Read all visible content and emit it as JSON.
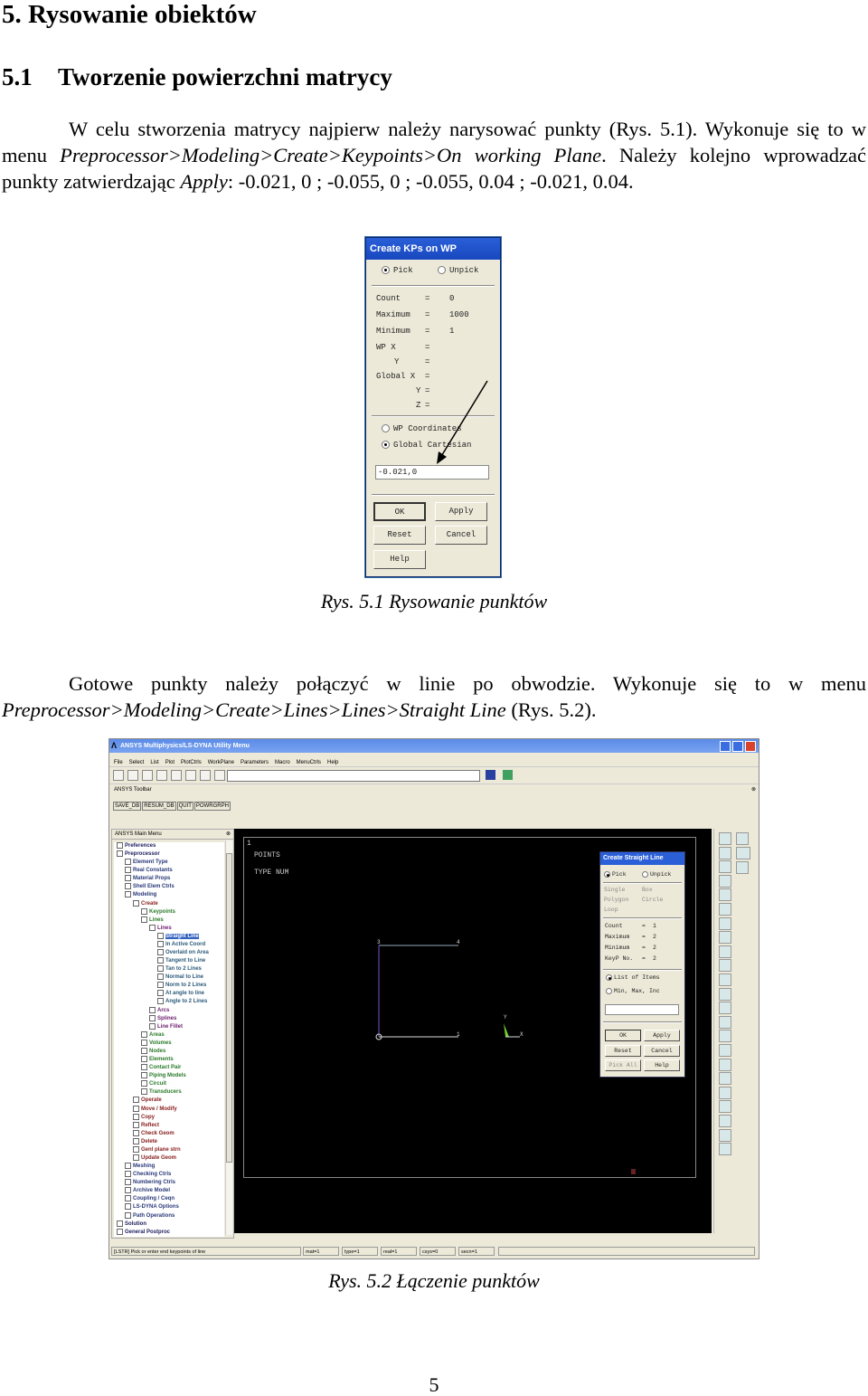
{
  "heading": "5. Rysowanie obiektów",
  "section": {
    "number": "5.1",
    "title": "Tworzenie powierzchni matrycy"
  },
  "para1": {
    "t1": "W celu stworzenia matrycy najpierw należy narysować punkty (Rys. 5.1). Wykonuje się to w menu ",
    "menu": "Preprocessor>Modeling>Create>Keypoints>On working Plane",
    "t2": ". Należy kolejno wprowadzać punkty zatwierdzając ",
    "apply": "Apply",
    "t3": ": -0.021, 0 ; -0.055, 0 ; -0.055, 0.04 ; -0.021, 0.04."
  },
  "fig1": {
    "title": "Create KPs on WP",
    "pick": "Pick",
    "unpick": "Unpick",
    "rows": [
      [
        "Count",
        "=",
        "0"
      ],
      [
        "Maximum",
        "=",
        "1000"
      ],
      [
        "Minimum",
        "=",
        "1"
      ],
      [
        "WP X",
        "=",
        ""
      ],
      [
        "Y",
        "=",
        ""
      ],
      [
        "Global X",
        "=",
        ""
      ],
      [
        "Y",
        "=",
        ""
      ],
      [
        "Z",
        "=",
        ""
      ]
    ],
    "wp_coords": "WP Coordinates",
    "global_cart": "Global Cartesian",
    "input_value": "-0.021,0",
    "ok": "OK",
    "apply": "Apply",
    "reset": "Reset",
    "cancel": "Cancel",
    "help": "Help",
    "caption": "Rys. 5.1 Rysowanie punktów"
  },
  "para2": {
    "t1": "Gotowe punkty należy połączyć w linie po obwodzie. Wykonuje się to w menu ",
    "menu": "Preprocessor>Modeling>Create>Lines>Lines>Straight Line",
    "t2": " (Rys. 5.2)."
  },
  "fig2": {
    "window_title": "ANSYS Multiphysics/LS-DYNA Utility Menu",
    "menu": [
      "File",
      "Select",
      "List",
      "Plot",
      "PlotCtrls",
      "WorkPlane",
      "Parameters",
      "Macro",
      "MenuCtrls",
      "Help"
    ],
    "toolbar_label": "ANSYS Toolbar",
    "toolbar_buttons": [
      "SAVE_DB",
      "RESUM_DB",
      "QUIT",
      "POWRGRPH"
    ],
    "main_menu_label": "ANSYS Main Menu",
    "tree": [
      {
        "label": "Preferences",
        "level": 0,
        "color": "#202060"
      },
      {
        "label": "Preprocessor",
        "level": 0,
        "color": "#202060"
      },
      {
        "label": "Element Type",
        "level": 1,
        "color": "#283878"
      },
      {
        "label": "Real Constants",
        "level": 1,
        "color": "#283878"
      },
      {
        "label": "Material Props",
        "level": 1,
        "color": "#283878"
      },
      {
        "label": "Shell Elem Ctrls",
        "level": 1,
        "color": "#283878"
      },
      {
        "label": "Modeling",
        "level": 1,
        "color": "#283878"
      },
      {
        "label": "Create",
        "level": 2,
        "color": "#8a2020"
      },
      {
        "label": "Keypoints",
        "level": 3,
        "color": "#2a7a2a"
      },
      {
        "label": "Lines",
        "level": 3,
        "color": "#2a7a2a"
      },
      {
        "label": "Lines",
        "level": 4,
        "color": "#702070"
      },
      {
        "label": "Straight Line",
        "level": 5,
        "color": "#ffffff",
        "selected": true
      },
      {
        "label": "In Active Coord",
        "level": 5,
        "color": "#2a5a7a"
      },
      {
        "label": "Overlaid on Area",
        "level": 5,
        "color": "#2a5a7a"
      },
      {
        "label": "Tangent to Line",
        "level": 5,
        "color": "#2a5a7a"
      },
      {
        "label": "Tan to 2 Lines",
        "level": 5,
        "color": "#2a5a7a"
      },
      {
        "label": "Normal to Line",
        "level": 5,
        "color": "#2a5a7a"
      },
      {
        "label": "Norm to 2 Lines",
        "level": 5,
        "color": "#2a5a7a"
      },
      {
        "label": "At angle to line",
        "level": 5,
        "color": "#2a5a7a"
      },
      {
        "label": "Angle to 2 Lines",
        "level": 5,
        "color": "#2a5a7a"
      },
      {
        "label": "Arcs",
        "level": 4,
        "color": "#702070"
      },
      {
        "label": "Splines",
        "level": 4,
        "color": "#702070"
      },
      {
        "label": "Line Fillet",
        "level": 4,
        "color": "#702070"
      },
      {
        "label": "Areas",
        "level": 3,
        "color": "#2a7a2a"
      },
      {
        "label": "Volumes",
        "level": 3,
        "color": "#2a7a2a"
      },
      {
        "label": "Nodes",
        "level": 3,
        "color": "#2a7a2a"
      },
      {
        "label": "Elements",
        "level": 3,
        "color": "#2a7a2a"
      },
      {
        "label": "Contact Pair",
        "level": 3,
        "color": "#2a7a2a"
      },
      {
        "label": "Piping Models",
        "level": 3,
        "color": "#2a7a2a"
      },
      {
        "label": "Circuit",
        "level": 3,
        "color": "#2a7a2a"
      },
      {
        "label": "Transducers",
        "level": 3,
        "color": "#2a7a2a"
      },
      {
        "label": "Operate",
        "level": 2,
        "color": "#8a2020"
      },
      {
        "label": "Move / Modify",
        "level": 2,
        "color": "#8a2020"
      },
      {
        "label": "Copy",
        "level": 2,
        "color": "#8a2020"
      },
      {
        "label": "Reflect",
        "level": 2,
        "color": "#8a2020"
      },
      {
        "label": "Check Geom",
        "level": 2,
        "color": "#8a2020"
      },
      {
        "label": "Delete",
        "level": 2,
        "color": "#8a2020"
      },
      {
        "label": "Genl plane strn",
        "level": 2,
        "color": "#8a2020"
      },
      {
        "label": "Update Geom",
        "level": 2,
        "color": "#8a2020"
      },
      {
        "label": "Meshing",
        "level": 1,
        "color": "#283878"
      },
      {
        "label": "Checking Ctrls",
        "level": 1,
        "color": "#283878"
      },
      {
        "label": "Numbering Ctrls",
        "level": 1,
        "color": "#283878"
      },
      {
        "label": "Archive Model",
        "level": 1,
        "color": "#283878"
      },
      {
        "label": "Coupling / Ceqn",
        "level": 1,
        "color": "#283878"
      },
      {
        "label": "LS-DYNA Options",
        "level": 1,
        "color": "#283878"
      },
      {
        "label": "Path Operations",
        "level": 1,
        "color": "#283878"
      },
      {
        "label": "Solution",
        "level": 0,
        "color": "#202060"
      },
      {
        "label": "General Postproc",
        "level": 0,
        "color": "#202060"
      }
    ],
    "graphics": {
      "window_num": "1",
      "label1": "POINTS",
      "label2": "TYPE NUM",
      "kp_labels": [
        "3",
        "4",
        "1"
      ],
      "axis_x": "X",
      "axis_y": "Y"
    },
    "dialog": {
      "title": "Create Straight Line",
      "pick": "Pick",
      "unpick": "Unpick",
      "single": "Single",
      "box": "Box",
      "polygon": "Polygon",
      "circle": "Circle",
      "loop": "Loop",
      "rows": [
        [
          "Count",
          "=",
          "1"
        ],
        [
          "Maximum",
          "=",
          "2"
        ],
        [
          "Minimum",
          "=",
          "2"
        ],
        [
          "KeyP No.",
          "=",
          "2"
        ]
      ],
      "list_items": "List of Items",
      "min_max_inc": "Min, Max, Inc",
      "ok": "OK",
      "apply": "Apply",
      "reset": "Reset",
      "cancel": "Cancel",
      "pick_all": "Pick All",
      "help": "Help"
    },
    "status_prompt": "[LSTR] Pick or enter end keypoints of line",
    "status_fields": [
      "mat=1",
      "type=1",
      "real=1",
      "csys=0",
      "secn=1"
    ],
    "caption": "Rys. 5.2 Łączenie punktów"
  },
  "page_number": "5"
}
